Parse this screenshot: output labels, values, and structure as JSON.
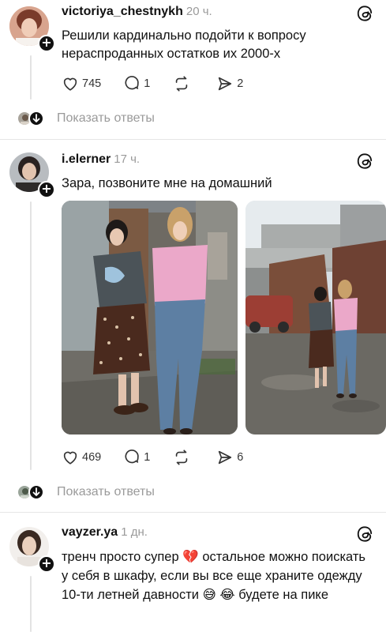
{
  "posts": [
    {
      "username": "victoriya_chestnykh",
      "time": "20 ч.",
      "text": "Решили кардинально подойти к вопросу нераспроданных остатков их 2000-х",
      "likes": "745",
      "comments": "1",
      "reposts": "",
      "shares": "2",
      "show_replies": "Показать ответы"
    },
    {
      "username": "i.elerner",
      "time": "17 ч.",
      "text": "Зара, позвоните мне на домашний",
      "likes": "469",
      "comments": "1",
      "reposts": "",
      "shares": "6",
      "show_replies": "Показать ответы"
    },
    {
      "username": "vayzer.ya",
      "time": "1 дн.",
      "text": "тренч просто супер 💔 остальное можно поискать у себя в шкафу, если вы все еще храните одежду 10-ти летней давности 😅 😂 будете на пике"
    }
  ],
  "icons": {
    "like": "heart-icon",
    "comment": "comment-icon",
    "repost": "repost-icon",
    "share": "share-icon",
    "threads": "threads-logo-icon",
    "follow": "plus-icon",
    "replies": "arrow-down-icon"
  },
  "colors": {
    "text": "#111111",
    "muted": "#9a9a9a",
    "divider": "#e6e6e6",
    "badge": "#111111"
  }
}
